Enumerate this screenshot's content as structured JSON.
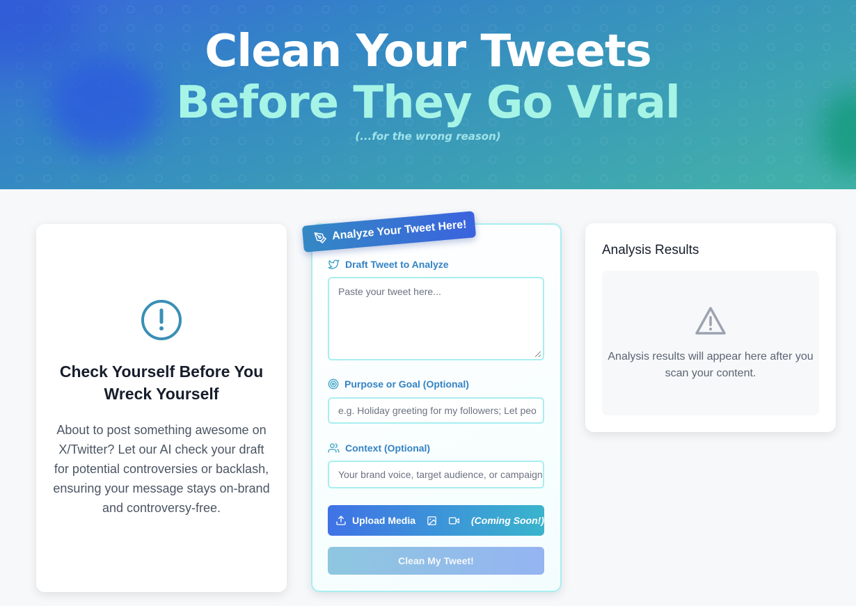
{
  "hero": {
    "title_line1": "Clean Your Tweets",
    "title_line2": "Before They Go Viral",
    "tagline": "(...for the wrong reason)"
  },
  "intro_card": {
    "icon": "alert-circle-icon",
    "heading": "Check Yourself Before You Wreck Yourself",
    "body": "About to post something awesome on X/Twitter? Let our AI check your draft for potential controversies or backlash, ensuring your message stays on-brand and controversy-free."
  },
  "form": {
    "badge": "Analyze Your Tweet Here!",
    "draft": {
      "label": "Draft Tweet to Analyze",
      "placeholder": "Paste your tweet here..."
    },
    "purpose": {
      "label": "Purpose or Goal (Optional)",
      "placeholder": "e.g. Holiday greeting for my followers; Let peo"
    },
    "context": {
      "label": "Context (Optional)",
      "placeholder": "Your brand voice, target audience, or campaign"
    },
    "upload": {
      "label": "Upload Media",
      "note": "(Coming Soon!)"
    },
    "submit_label": "Clean My Tweet!"
  },
  "results": {
    "title": "Analysis Results",
    "icon": "warning-triangle-icon",
    "empty_message": "Analysis results will appear here after you scan your content."
  },
  "colors": {
    "accent_teal": "#3a8ec4",
    "accent_blue": "#3f72e6",
    "title_highlight": "#a6f4e6"
  }
}
